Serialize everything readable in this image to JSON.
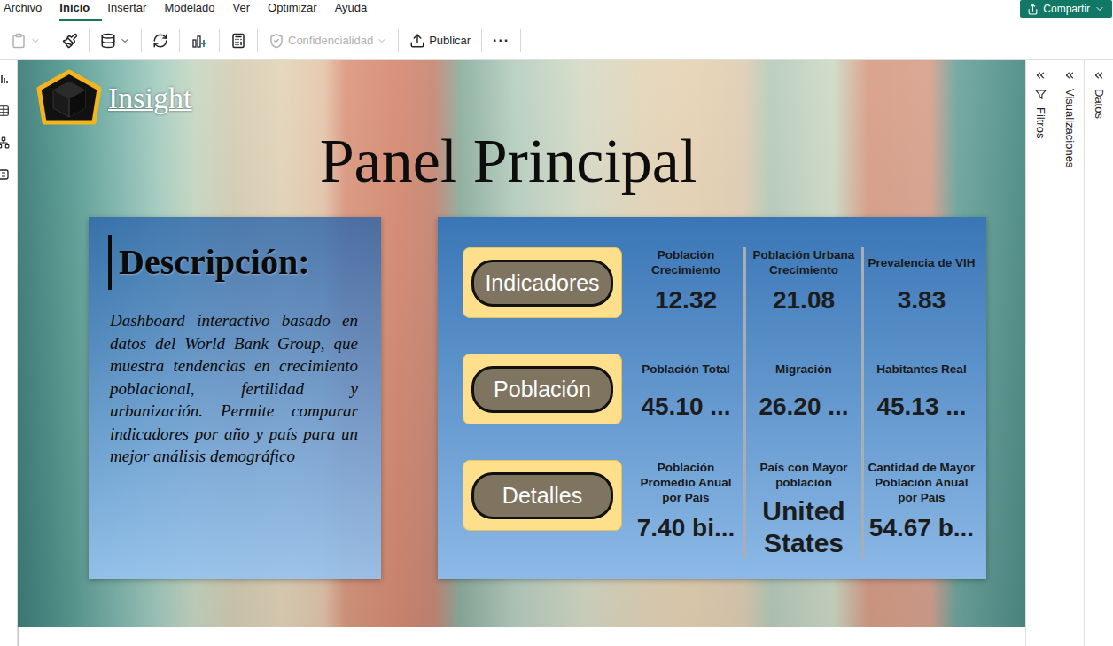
{
  "menu": {
    "tabs": [
      {
        "label": "Archivo",
        "selected": false
      },
      {
        "label": "Inicio",
        "selected": true
      },
      {
        "label": "Insertar",
        "selected": false
      },
      {
        "label": "Modelado",
        "selected": false
      },
      {
        "label": "Ver",
        "selected": false
      },
      {
        "label": "Optimizar",
        "selected": false
      },
      {
        "label": "Ayuda",
        "selected": false
      }
    ],
    "share_button": "Compartir"
  },
  "toolbar": {
    "items": [
      {
        "kind": "icon",
        "disabled": true,
        "dropdown": true
      },
      {
        "kind": "icon",
        "disabled": false,
        "dropdown": false
      },
      {
        "kind": "icon",
        "disabled": false,
        "dropdown": true
      },
      {
        "kind": "icon",
        "disabled": false,
        "dropdown": false
      },
      {
        "kind": "icon",
        "disabled": false,
        "dropdown": false
      },
      {
        "kind": "icon",
        "disabled": false,
        "dropdown": false
      },
      {
        "kind": "label",
        "label": "Confidencialidad",
        "disabled": true,
        "dropdown": true
      },
      {
        "kind": "label",
        "label": "Publicar",
        "disabled": false,
        "dropdown": false
      },
      {
        "kind": "more",
        "label": "···",
        "disabled": false,
        "dropdown": false
      }
    ]
  },
  "panes": [
    {
      "label": "Filtros"
    },
    {
      "label": "Visualizaciones"
    },
    {
      "label": "Datos"
    }
  ],
  "report": {
    "logo": "Insight",
    "title": "Panel Principal",
    "description": {
      "heading": "Descripción:",
      "text": "Dashboard interactivo basado en datos del World Bank Group, que muestra tendencias en crecimiento poblacional, fertilidad y urbanización. Permite comparar indicadores por año y país para un mejor análisis demográfico"
    },
    "nav_buttons": [
      "Indicadores",
      "Población",
      "Detalles"
    ],
    "kpi_rows": [
      [
        {
          "label": "Población Crecimiento",
          "value": "12.32"
        },
        {
          "label": "Población Urbana Crecimiento",
          "value": "21.08"
        },
        {
          "label": "Prevalencia de VIH",
          "value": "3.83"
        }
      ],
      [
        {
          "label": "Población Total",
          "value": "45.10 ..."
        },
        {
          "label": "Migración",
          "value": "26.20 ..."
        },
        {
          "label": "Habitantes Real",
          "value": "45.13 ..."
        }
      ],
      [
        {
          "label": "Población Promedio Anual por País",
          "value": "7.40 bi..."
        },
        {
          "label": "País con Mayor población",
          "value": "United States"
        },
        {
          "label": "Cantidad de Mayor Población Anual por País",
          "value": "54.67 b..."
        }
      ]
    ]
  }
}
